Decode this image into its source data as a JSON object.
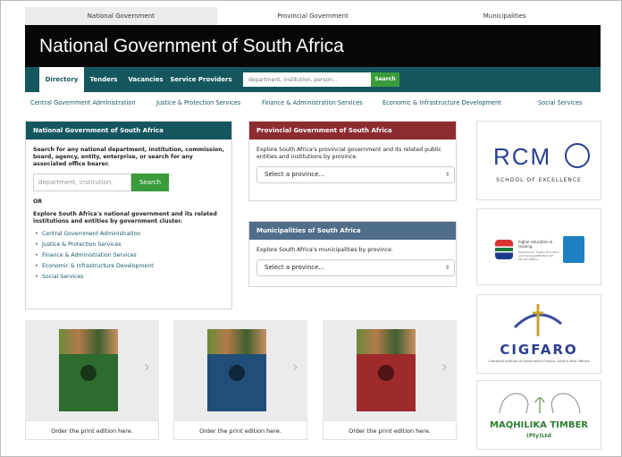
{
  "top_tabs": [
    "National Government",
    "Provincial Government",
    "Municipalities"
  ],
  "site_title": "National Government of South Africa",
  "nav": {
    "tabs": [
      "Directory",
      "Tenders",
      "Vacancies",
      "Service Providers"
    ],
    "search_placeholder": "department, institution, person...",
    "search_button": "Search"
  },
  "clusters": [
    "Central Government Administration",
    "Justice & Protection Services",
    "Finance & Administration Services",
    "Economic & Infrastructure Development",
    "Social Services"
  ],
  "national_panel": {
    "title": "National Government of South Africa",
    "intro": "Search for any national department, institution, commission, board, agency, entity, enterprise, or search for any associated office bearer.",
    "search_placeholder": "department, institution,",
    "search_button": "Search",
    "or": "OR",
    "explore": "Explore South Africa's national government and its related institutions and entities by government cluster.",
    "links": [
      "Central Government Administration",
      "Justice & Protection Services",
      "Finance & Administration Services",
      "Economic & Infrastructure Development",
      "Social Services"
    ]
  },
  "provincial_panel": {
    "title": "Provincial Government of South Africa",
    "text": "Explore South Africa's provincial government and its related public entities and institutions by province.",
    "select": "Select a province..."
  },
  "municipal_panel": {
    "title": "Municipalities of South Africa",
    "text": "Explore South Africa's municipalities by province.",
    "select": "Select a province..."
  },
  "books": [
    {
      "caption": "Order the print edition here.",
      "cover_color": "#2e6b2e"
    },
    {
      "caption": "Order the print edition here.",
      "cover_color": "#1f4e79"
    },
    {
      "caption": "Order the print edition here.",
      "cover_color": "#9e2a2b"
    }
  ],
  "ads": {
    "rcm": {
      "name": "RCM",
      "tagline": "SCHOOL OF EXCELLENCE"
    },
    "dhet": {
      "text": "higher education & training",
      "sub": "Department: Higher Education and Training REPUBLIC OF SOUTH AFRICA"
    },
    "cigfaro": {
      "name": "CIGFARO",
      "sub": "Chartered Institute of Government Finance, Audit & Risk Officers"
    },
    "maqhilika": {
      "name": "MAQHILIKA TIMBER",
      "sub": "(Pty)Ltd"
    }
  }
}
